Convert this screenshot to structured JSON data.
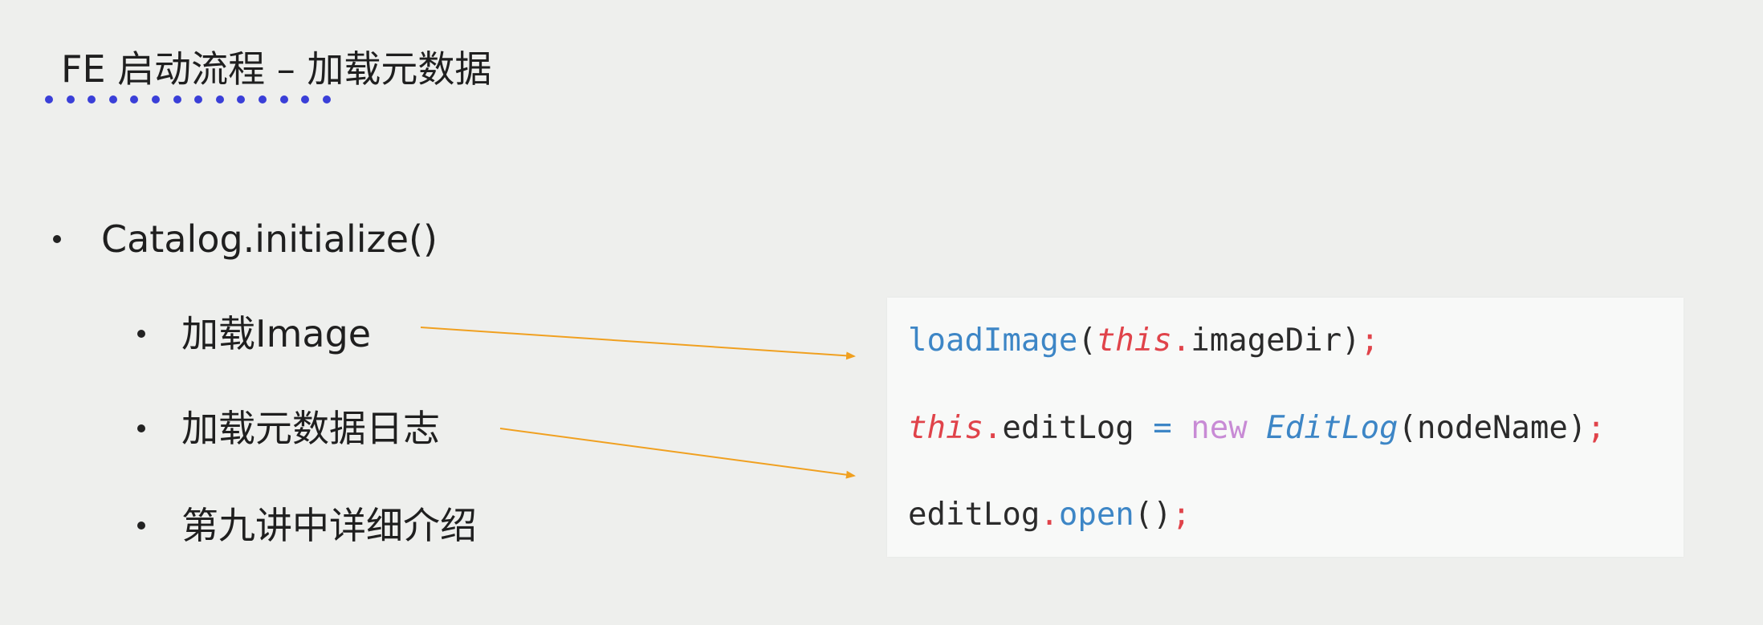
{
  "title": "FE 启动流程 – 加载元数据",
  "bullets": {
    "main": "Catalog.initialize()",
    "sub": [
      "加载Image",
      "加载元数据日志",
      "第九讲中详细介绍"
    ]
  },
  "code": {
    "line1": {
      "fn": "loadImage",
      "open": "(",
      "kw": "this",
      "dot": ".",
      "arg": "imageDir",
      "close": ")",
      "semi": ";"
    },
    "line2": {
      "kw": "this",
      "dot": ".",
      "field": "editLog",
      "eq": " = ",
      "new": "new",
      "type": "EditLog",
      "args": "(nodeName)",
      "semi": ";"
    },
    "line3": {
      "obj": "editLog",
      "dot": ".",
      "fn": "open",
      "args": "()",
      "semi": ";"
    }
  },
  "colors": {
    "background": "#eeefed",
    "title_underline": "#3a3fd8",
    "arrow": "#f0a020",
    "code_function": "#3d86c6",
    "code_keyword": "#e0434a",
    "code_new": "#c88bd5"
  }
}
